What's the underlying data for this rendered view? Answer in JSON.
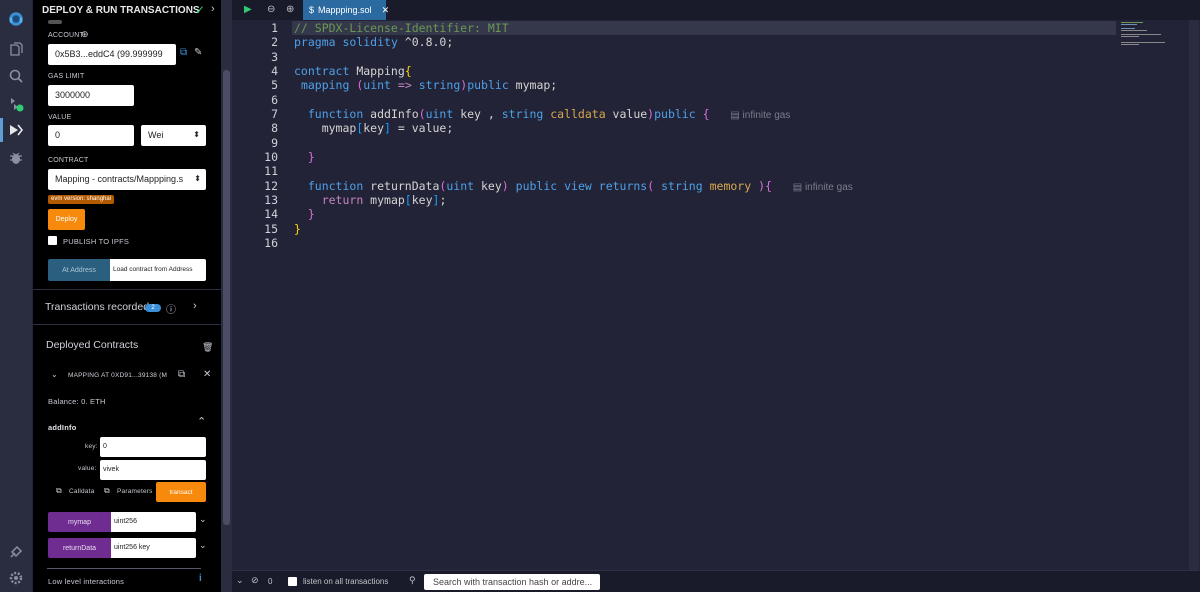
{
  "panel": {
    "title": "DEPLOY & RUN TRANSACTIONS",
    "account_label": "ACCOUNT",
    "account_value": "0x5B3...eddC4 (99.999999",
    "gas_limit_label": "GAS LIMIT",
    "gas_limit_value": "3000000",
    "value_label": "VALUE",
    "value_amount": "0",
    "value_unit": "Wei",
    "contract_label": "CONTRACT",
    "contract_value": "Mapping - contracts/Mappping.s",
    "evm_badge": "evm version: shanghai",
    "deploy_label": "Deploy",
    "publish_label": "PUBLISH TO IPFS",
    "at_address_label": "At Address",
    "load_contract_placeholder": "Load contract from Address",
    "transactions_recorded_label": "Transactions recorded",
    "transactions_recorded_count": "2",
    "deployed_contracts_label": "Deployed Contracts",
    "instance_label": "MAPPING AT 0XD91...39138 (M",
    "balance": "Balance: 0. ETH",
    "addinfo_title": "addInfo",
    "key_label": "key:",
    "key_value": "0",
    "value_field_label": "value:",
    "value_field_value": "vivek",
    "calldata_label": "Calldata",
    "parameters_label": "Parameters",
    "transact_label": "transact",
    "mymap_label": "mymap",
    "mymap_input": "uint256",
    "returndata_label": "returnData",
    "returndata_input": "uint256 key",
    "low_level_label": "Low level interactions"
  },
  "editor": {
    "tab_name": "Mappping.sol",
    "gas_hint": "infinite gas",
    "lines": [
      "1",
      "2",
      "3",
      "4",
      "5",
      "6",
      "7",
      "8",
      "9",
      "10",
      "11",
      "12",
      "13",
      "14",
      "15",
      "16"
    ]
  },
  "terminal": {
    "count": "0",
    "listen_label": "listen on all transactions",
    "search_placeholder": "Search with transaction hash or addre..."
  },
  "colors": {
    "accent_orange": "#f78a0c",
    "accent_purple": "#6f2c91",
    "tab_blue": "#2b6aa0",
    "compiled_check": "#2ecc71"
  }
}
